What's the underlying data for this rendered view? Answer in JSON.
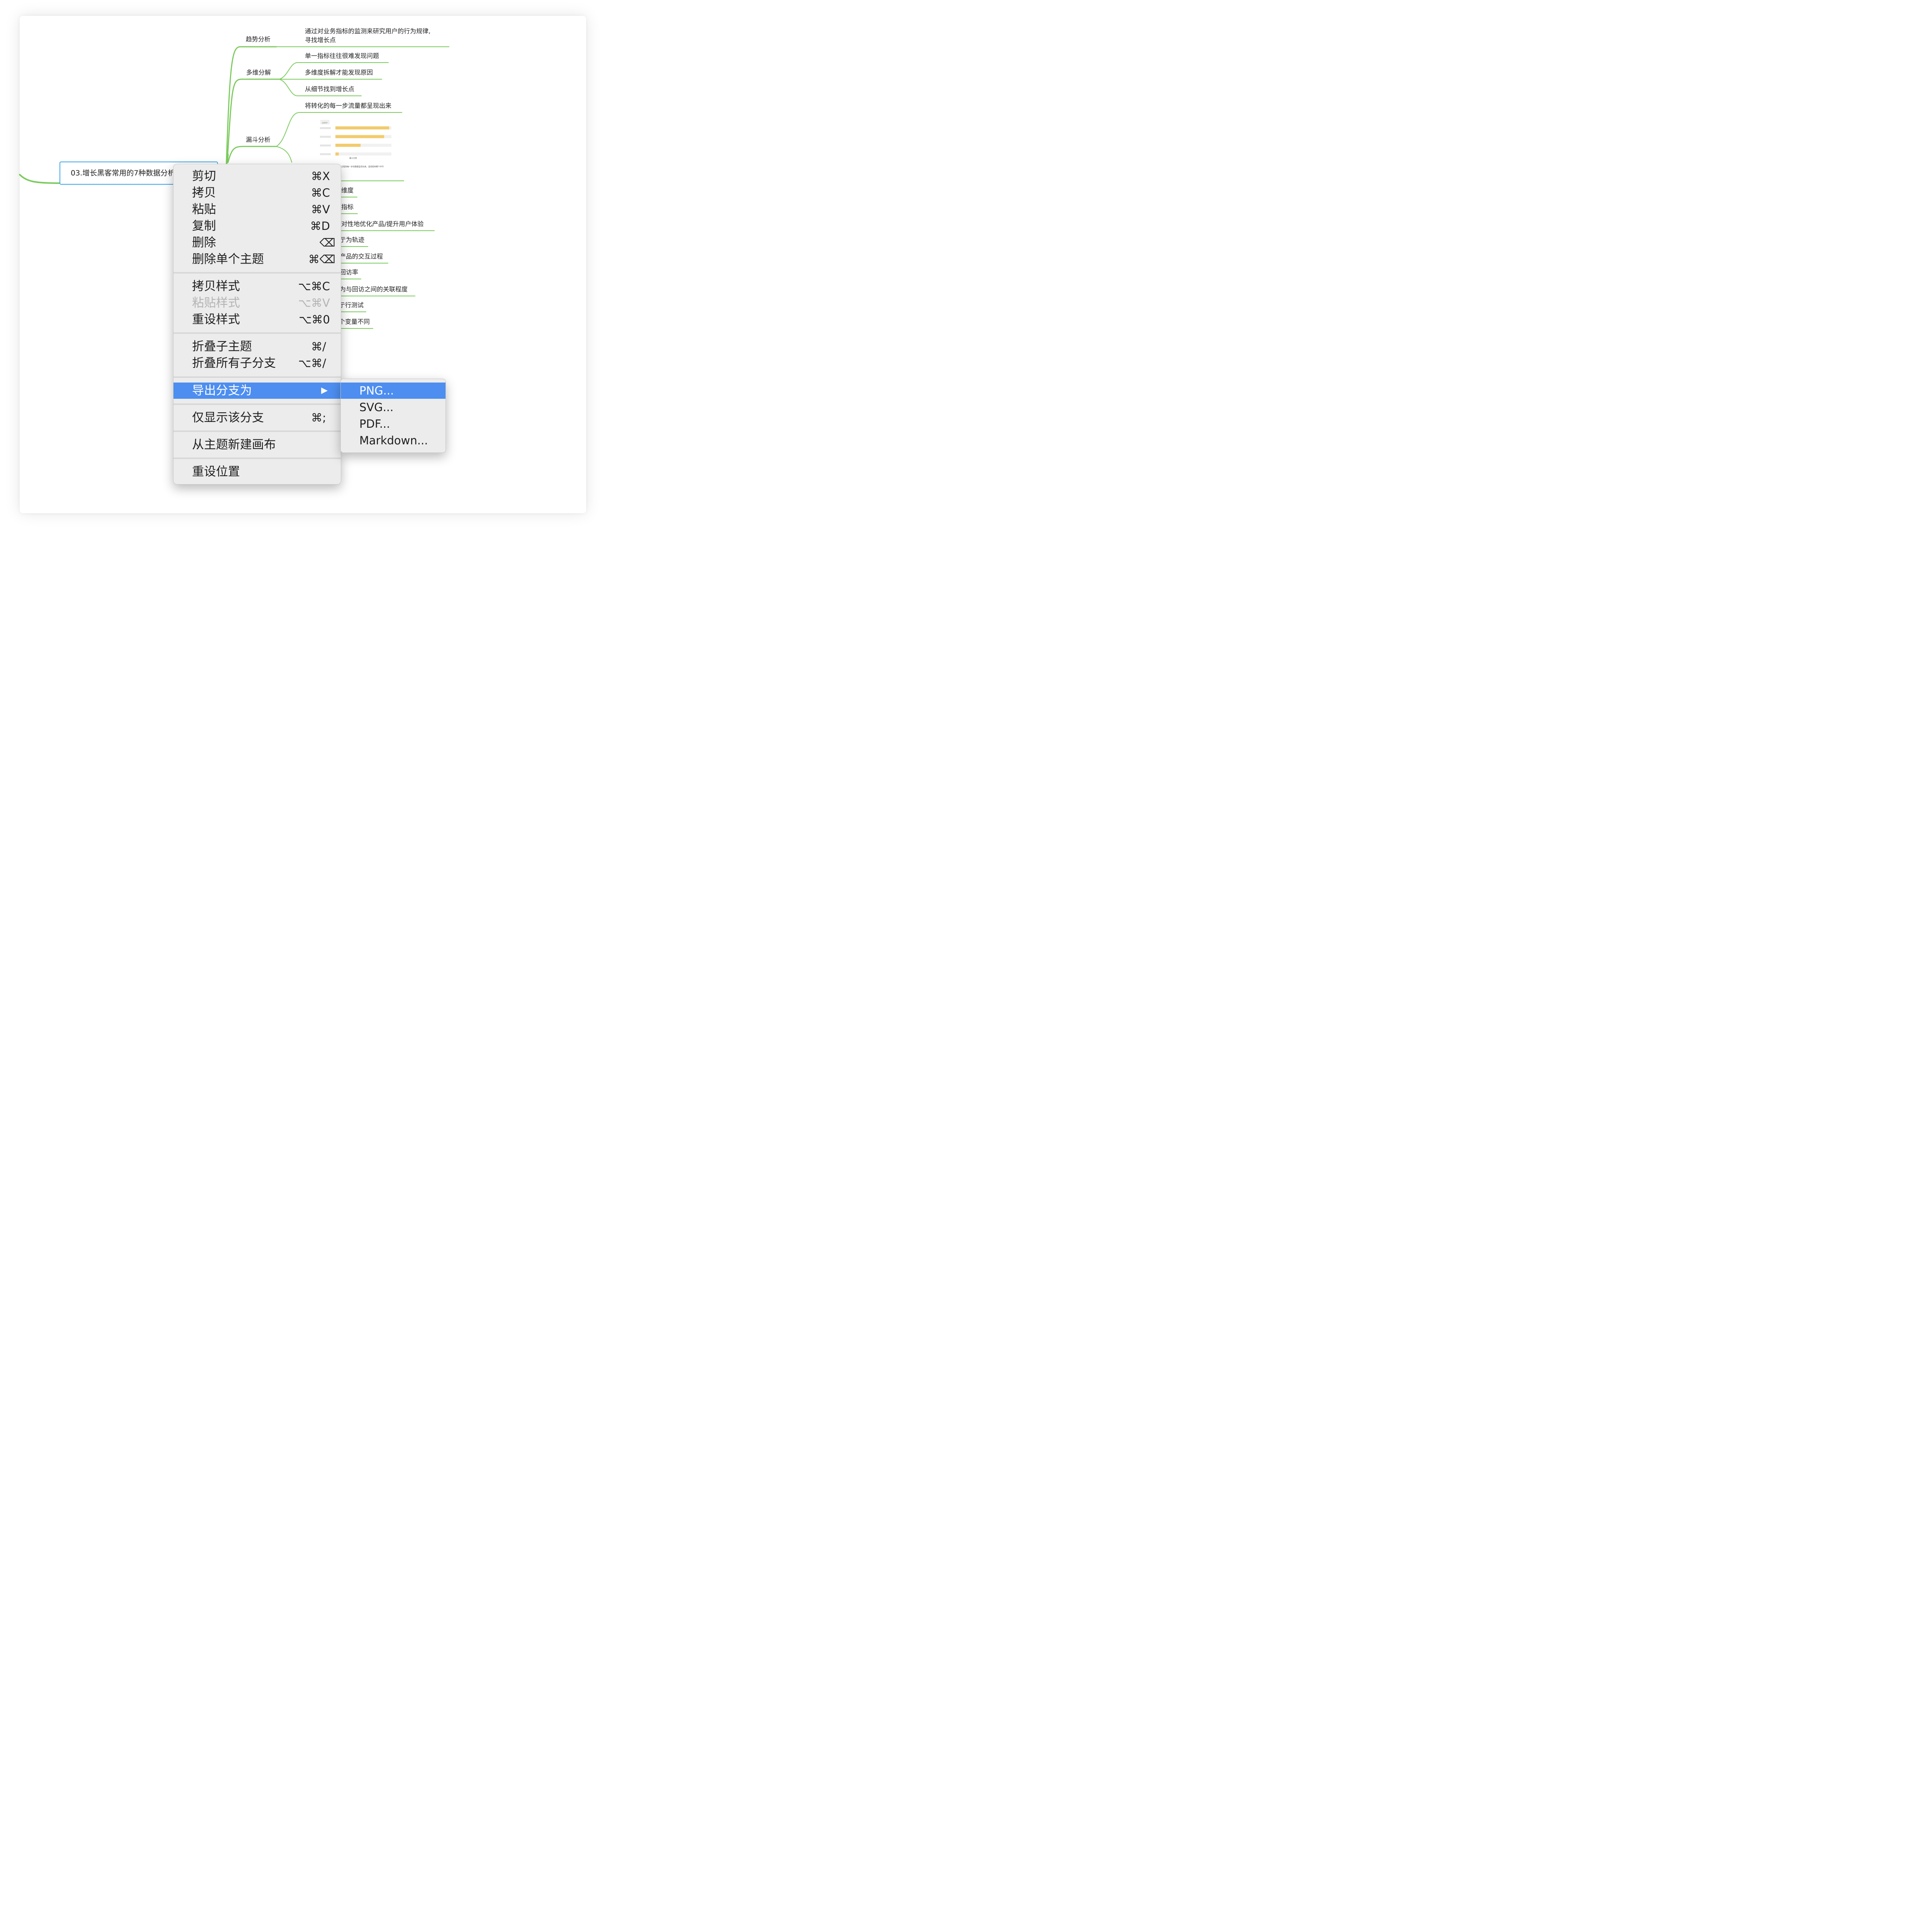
{
  "mindmap": {
    "root_label": "03.增长黑客常用的7种数据分析",
    "branches": {
      "trend": "趋势分析",
      "multi_dim": "多维分解",
      "funnel": "漏斗分析"
    },
    "leaves": {
      "trend_line1": "通过对业务指标的监测来研究用户的行为规律,",
      "trend_line2": "寻找增长点",
      "multi_1": "单一指标往往很难发现问题",
      "multi_2": "多维度拆解才能发现原因",
      "multi_3": "从细节找到增长点",
      "funnel_1": "将转化的每一步流量都呈现出来",
      "partial_1": "维度",
      "partial_2": "指标",
      "partial_3": "对性地优化产品/提升用户体验",
      "partial_4": "亍为轨迹",
      "partial_5": "产品的交互过程",
      "partial_6": "回访率",
      "partial_7": "为与回访之间的关联程度",
      "partial_8": "亍行测试",
      "partial_9": "个变量不同"
    },
    "funnel_image": {
      "header": "全部用户",
      "bars": [
        0.96,
        0.87,
        0.45,
        0.06
      ],
      "caption": "漏斗分析",
      "note": "此过程将每一步流量都呈现出来，直观看到哪个环节"
    }
  },
  "context_menu": {
    "items": {
      "cut": {
        "label": "剪切",
        "shortcut": "⌘X"
      },
      "copy": {
        "label": "拷贝",
        "shortcut": "⌘C"
      },
      "paste": {
        "label": "粘贴",
        "shortcut": "⌘V"
      },
      "duplicate": {
        "label": "复制",
        "shortcut": "⌘D"
      },
      "delete": {
        "label": "删除",
        "shortcut": "⌫"
      },
      "delete_single": {
        "label": "删除单个主题",
        "shortcut": "⌘⌫"
      },
      "copy_style": {
        "label": "拷贝样式",
        "shortcut": "⌥⌘C"
      },
      "paste_style": {
        "label": "粘贴样式",
        "shortcut": "⌥⌘V"
      },
      "reset_style": {
        "label": "重设样式",
        "shortcut": "⌥⌘0"
      },
      "collapse_children": {
        "label": "折叠子主题",
        "shortcut": "⌘/"
      },
      "collapse_all": {
        "label": "折叠所有子分支",
        "shortcut": "⌥⌘/"
      },
      "export_branch": {
        "label": "导出分支为",
        "shortcut": "▶"
      },
      "show_branch_only": {
        "label": "仅显示该分支",
        "shortcut": "⌘;"
      },
      "new_canvas": {
        "label": "从主题新建画布",
        "shortcut": ""
      },
      "reset_position": {
        "label": "重设位置",
        "shortcut": ""
      }
    }
  },
  "export_submenu": {
    "png": "PNG...",
    "svg": "SVG...",
    "pdf": "PDF...",
    "markdown": "Markdown..."
  },
  "colors": {
    "branch_line": "#7ccb5e",
    "root_border": "#3da6e8",
    "menu_highlight": "#4d8ef0",
    "funnel_bar": "#f2cb6b"
  }
}
